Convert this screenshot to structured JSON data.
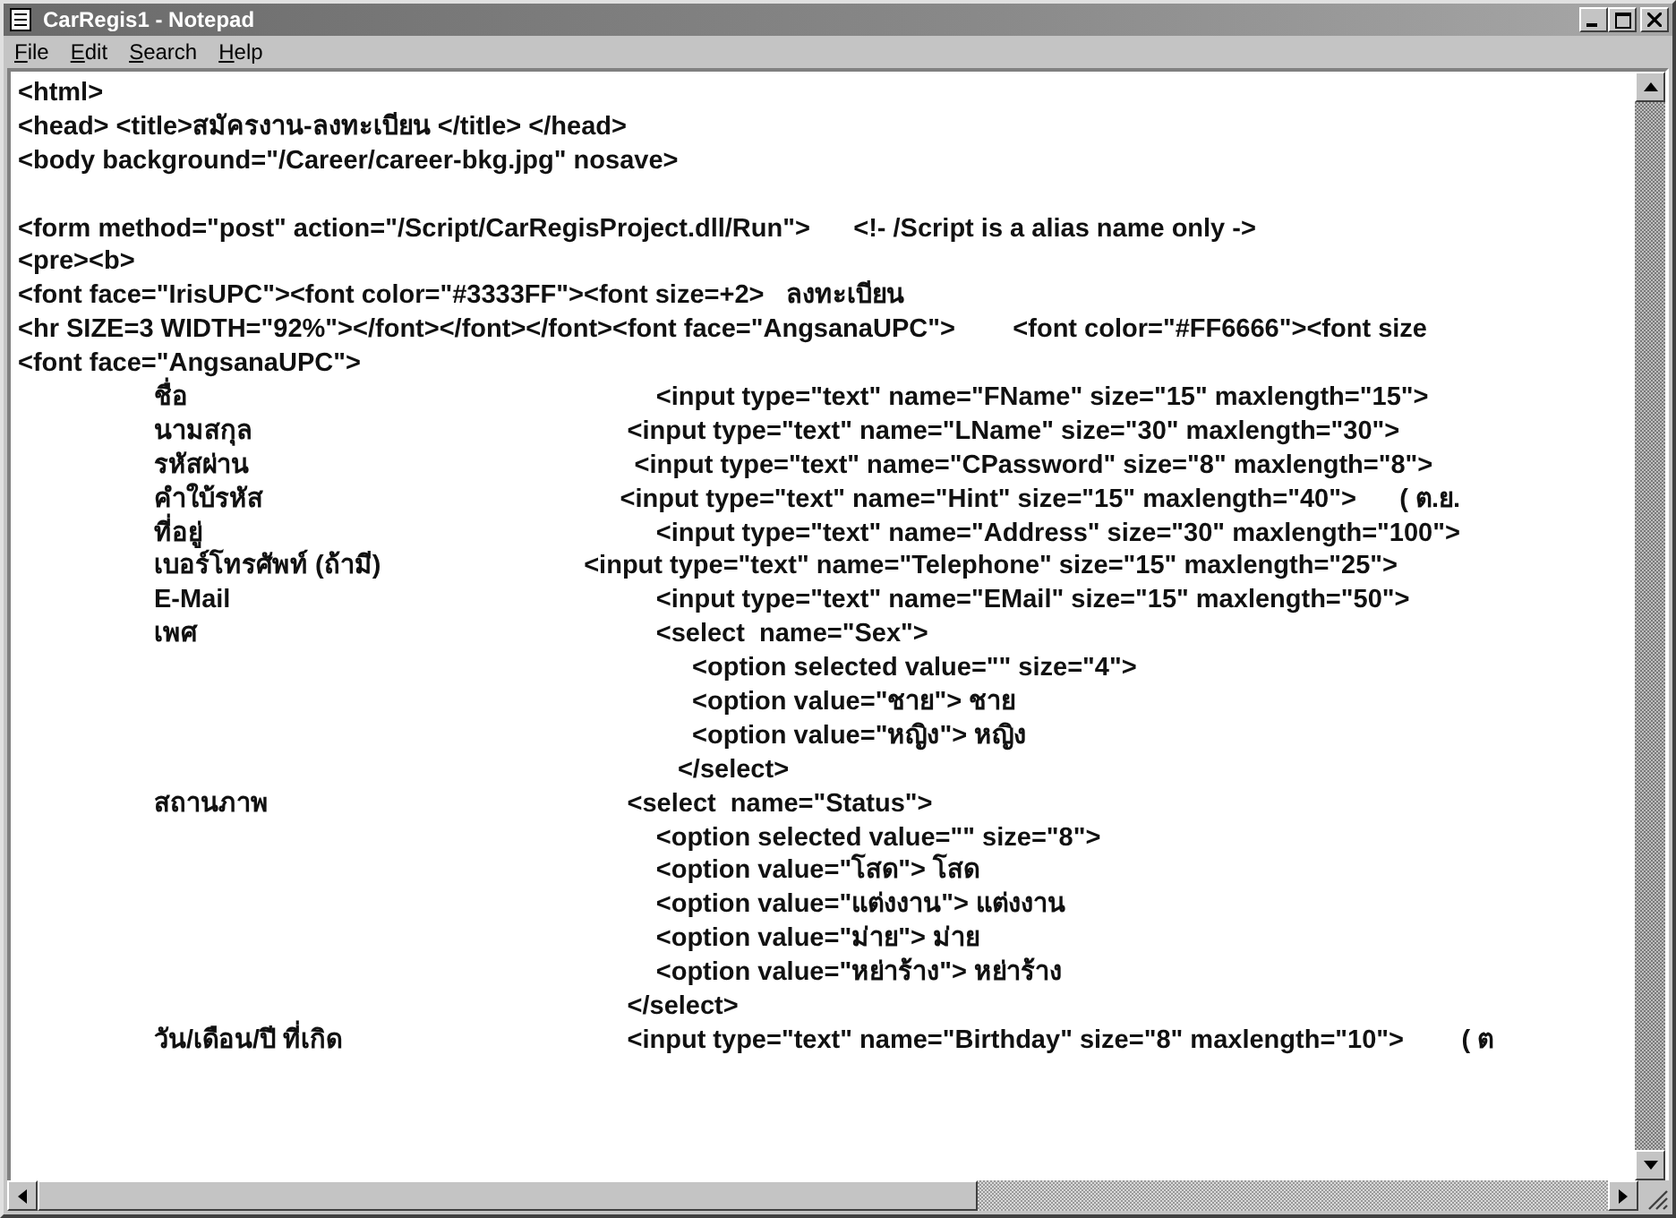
{
  "window": {
    "title": "CarRegis1 - Notepad"
  },
  "menu": [
    "File",
    "Edit",
    "Search",
    "Help"
  ],
  "editor": {
    "lines": [
      {
        "kind": "code",
        "text": "<html>"
      },
      {
        "kind": "code",
        "text": "<head> <title>สมัครงาน-ลงทะเบียน </title> </head>"
      },
      {
        "kind": "code",
        "text": "<body background=\"/Career/career-bkg.jpg\" nosave>"
      },
      {
        "kind": "blank"
      },
      {
        "kind": "code",
        "text": "<form method=\"post\" action=\"/Script/CarRegisProject.dll/Run\">      <!- /Script is a alias name only ->"
      },
      {
        "kind": "code",
        "text": "<pre><b>"
      },
      {
        "kind": "code",
        "text": "<font face=\"IrisUPC\"><font color=\"#3333FF\"><font size=+2>   ลงทะเบียน"
      },
      {
        "kind": "code",
        "text": "<hr SIZE=3 WIDTH=\"92%\"></font></font></font><font face=\"AngsanaUPC\">        <font color=\"#FF6666\"><font size"
      },
      {
        "kind": "code",
        "text": "<font face=\"AngsanaUPC\">"
      },
      {
        "kind": "code",
        "text": "\tชื่อ\t\t\t             <input type=\"text\" name=\"FName\" size=\"15\" maxlength=\"15\">"
      },
      {
        "kind": "code",
        "text": "\tนามสกุล\t\t\t         <input type=\"text\" name=\"LName\" size=\"30\" maxlength=\"30\">"
      },
      {
        "kind": "code",
        "text": "\tรหัสผ่าน\t\t\t          <input type=\"text\" name=\"CPassword\" size=\"8\" maxlength=\"8\">"
      },
      {
        "kind": "code",
        "text": "\tคำใบ้รหัส\t\t\t        <input type=\"text\" name=\"Hint\" size=\"15\" maxlength=\"40\">      ( ต.ย."
      },
      {
        "kind": "code",
        "text": "\tที่อยู่\t\t\t             <input type=\"text\" name=\"Address\" size=\"30\" maxlength=\"100\">"
      },
      {
        "kind": "code",
        "text": "\tเบอร์โทรศัพท์ (ถ้ามี)\t\t   <input type=\"text\" name=\"Telephone\" size=\"15\" maxlength=\"25\">"
      },
      {
        "kind": "code",
        "text": "\tE-Mail\t\t\t             <input type=\"text\" name=\"EMail\" size=\"15\" maxlength=\"50\">"
      },
      {
        "kind": "code",
        "text": "\tเพศ\t\t\t             <select  name=\"Sex\">"
      },
      {
        "kind": "code",
        "text": "\t\t\t\t                  <option selected value=\"\" size=\"4\">"
      },
      {
        "kind": "code",
        "text": "\t\t\t\t                  <option value=\"ชาย\"> ชาย"
      },
      {
        "kind": "code",
        "text": "\t\t\t\t                  <option value=\"หญิง\"> หญิง"
      },
      {
        "kind": "code",
        "text": "\t\t\t\t                </select>"
      },
      {
        "kind": "code",
        "text": "\tสถานภาพ\t\t\t         <select  name=\"Status\">"
      },
      {
        "kind": "code",
        "text": "\t\t\t\t             <option selected value=\"\" size=\"8\">"
      },
      {
        "kind": "code",
        "text": "\t\t\t\t             <option value=\"โสด\"> โสด"
      },
      {
        "kind": "code",
        "text": "\t\t\t\t             <option value=\"แต่งงาน\"> แต่งงาน"
      },
      {
        "kind": "code",
        "text": "\t\t\t\t             <option value=\"ม่าย\"> ม่าย"
      },
      {
        "kind": "code",
        "text": "\t\t\t\t             <option value=\"หย่าร้าง\"> หย่าร้าง"
      },
      {
        "kind": "code",
        "text": "\t\t\t\t         </select>"
      },
      {
        "kind": "code",
        "text": "\tวัน/เดือน/ปี ที่เกิด\t\t         <input type=\"text\" name=\"Birthday\" size=\"8\" maxlength=\"10\">        ( ต"
      }
    ]
  }
}
